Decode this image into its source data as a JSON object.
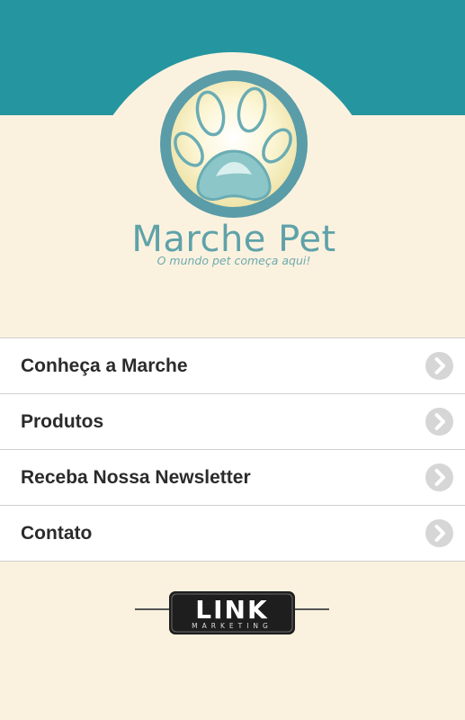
{
  "header": {
    "brand": "Marche Pet",
    "tagline": "O mundo pet começa aqui!",
    "logo_icon": "paw-icon"
  },
  "menu": {
    "items": [
      {
        "label": "Conheça a Marche",
        "icon": "chevron-right-icon"
      },
      {
        "label": "Produtos",
        "icon": "chevron-right-icon"
      },
      {
        "label": "Receba Nossa Newsletter",
        "icon": "chevron-right-icon"
      },
      {
        "label": "Contato",
        "icon": "chevron-right-icon"
      }
    ]
  },
  "footer": {
    "logo_text": "LINK",
    "logo_subtext": "MARKETING"
  },
  "colors": {
    "header_teal": "#2595a0",
    "background_cream": "#faf2df",
    "logo_teal": "#5fa2a9",
    "chevron_gray": "#d6d6d6"
  }
}
